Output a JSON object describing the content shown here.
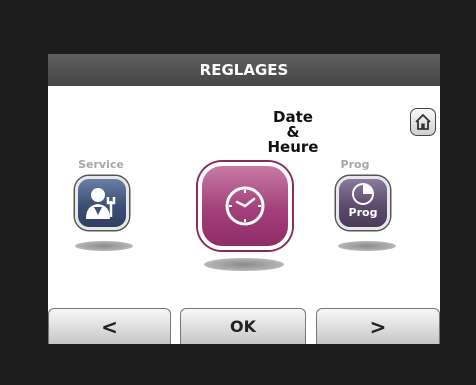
{
  "header": {
    "title": "REGLAGES"
  },
  "menu": {
    "left": {
      "label": "Service",
      "icon": "service-technician-icon"
    },
    "center": {
      "label_lines": [
        "Date",
        "&",
        "Heure"
      ],
      "icon": "clock-icon",
      "accent": "#a33f7a"
    },
    "right": {
      "label": "Prog",
      "icon_text": "Prog",
      "icon": "pie-clock-icon"
    }
  },
  "home": {
    "icon": "home-icon"
  },
  "nav": {
    "prev": "<",
    "ok": "OK",
    "next": ">"
  },
  "colors": {
    "service_tile": "#3c4f74",
    "prog_tile": "#5c4c6d",
    "title_bar": "#4f4f4f"
  }
}
